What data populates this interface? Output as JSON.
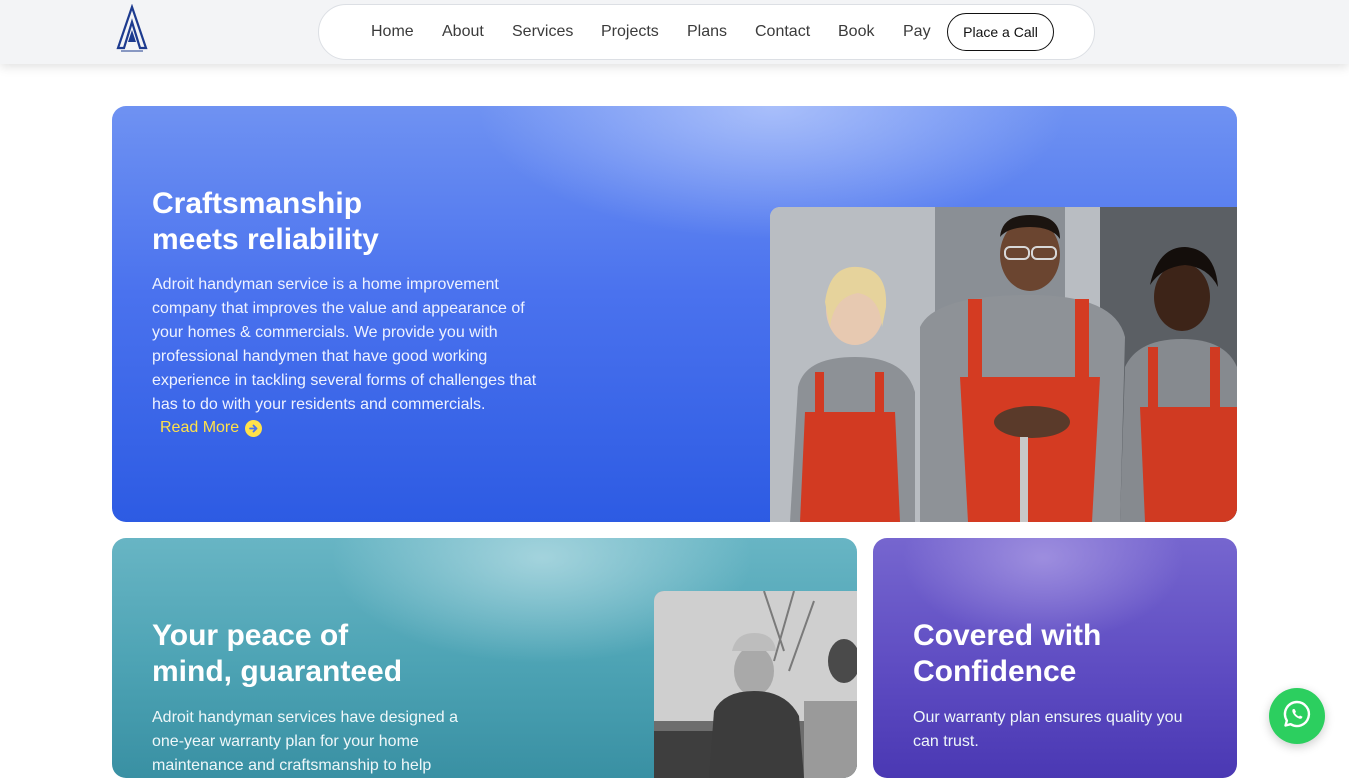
{
  "header": {
    "logo_icon": "adroit-logo",
    "nav": [
      "Home",
      "About",
      "Services",
      "Projects",
      "Plans",
      "Contact",
      "Book",
      "Pay"
    ],
    "call_button": "Place a Call"
  },
  "hero": {
    "title_line1": "Craftsmanship",
    "title_line2": "meets reliability",
    "description": "Adroit handyman service is a home improvement company that improves the value and appearance of your homes & commercials. We provide you with professional handymen that have good working experience in tackling several forms of challenges that has to do with your residents and commercials.",
    "read_more": "Read More",
    "read_more_icon": "arrow-right-circle-icon",
    "accent_color": "#ffe14a"
  },
  "warranty_card": {
    "title_line1": "Your peace of",
    "title_line2": "mind, guaranteed",
    "description": "Adroit handyman services have designed a one-year warranty plan for your home maintenance and craftsmanship to help"
  },
  "covered_card": {
    "title_line1": "Covered with",
    "title_line2": "Confidence",
    "description": "Our warranty plan ensures quality you can trust."
  },
  "floating": {
    "whatsapp_icon": "whatsapp-icon",
    "whatsapp_color": "#2ccf5f"
  }
}
